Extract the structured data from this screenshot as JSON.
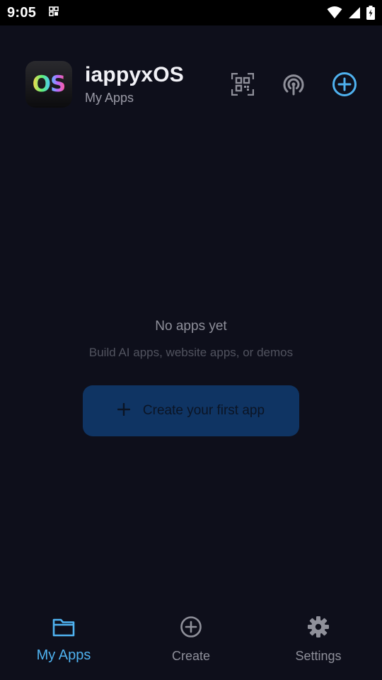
{
  "status_bar": {
    "time": "9:05",
    "icons": [
      "notification-grid-icon",
      "wifi-icon",
      "signal-icon",
      "battery-charging-icon"
    ]
  },
  "header": {
    "logo_text": "OS",
    "title": "iappyxOS",
    "subtitle": "My Apps",
    "actions": [
      "qr-scan-icon",
      "broadcast-icon",
      "add-circle-icon"
    ]
  },
  "empty_state": {
    "title": "No apps yet",
    "subtitle": "Build AI apps, website apps, or demos",
    "button_label": "Create your first app",
    "button_icon": "plus-icon"
  },
  "bottom_nav": {
    "items": [
      {
        "label": "My Apps",
        "icon": "folder-icon",
        "active": true
      },
      {
        "label": "Create",
        "icon": "add-circle-icon",
        "active": false
      },
      {
        "label": "Settings",
        "icon": "gear-icon",
        "active": false
      }
    ]
  },
  "colors": {
    "background": "#0e0f1b",
    "accent": "#4fb2f0",
    "button_bg": "#0f3463",
    "muted_text": "#8e8f9a"
  }
}
